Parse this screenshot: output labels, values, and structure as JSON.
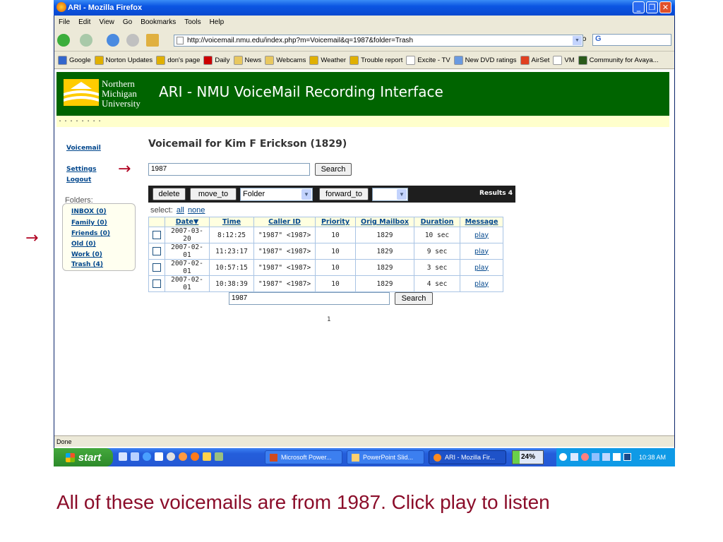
{
  "window": {
    "title": "ARI - Mozilla Firefox"
  },
  "menu": [
    "File",
    "Edit",
    "View",
    "Go",
    "Bookmarks",
    "Tools",
    "Help"
  ],
  "address": {
    "url": "http://voicemail.nmu.edu/index.php?m=Voicemail&q=1987&folder=Trash",
    "go_label": "Go",
    "search_engine": "G"
  },
  "bookmarks": [
    {
      "label": "Google",
      "color": "#3366cc"
    },
    {
      "label": "Norton Updates",
      "color": "#e0b000"
    },
    {
      "label": "don's page",
      "color": "#e0b000"
    },
    {
      "label": "Daily",
      "color": "#cc0000"
    },
    {
      "label": "News",
      "color": "#e8c860"
    },
    {
      "label": "Webcams",
      "color": "#e8c860"
    },
    {
      "label": "Weather",
      "color": "#e0b000"
    },
    {
      "label": "Trouble report",
      "color": "#e0b000"
    },
    {
      "label": "Excite - TV",
      "color": "#ffffff"
    },
    {
      "label": "New DVD ratings",
      "color": "#6a9ae0"
    },
    {
      "label": "AirSet",
      "color": "#e04020"
    },
    {
      "label": "VM",
      "color": "#ffffff"
    },
    {
      "label": "Community for Avaya...",
      "color": "#2a5a1a"
    }
  ],
  "header": {
    "logo_lines": [
      "Northern",
      "Michigan",
      "University"
    ],
    "title": "ARI - NMU VoiceMail Recording Interface",
    "dots": "........"
  },
  "nav": {
    "voicemail": "Voicemail",
    "settings": "Settings",
    "logout": "Logout",
    "folders_label": "Folders:"
  },
  "folders": [
    "INBOX (0)",
    "Family (0)",
    "Friends (0)",
    "Old (0)",
    "Work (0)",
    "Trash (4)"
  ],
  "page": {
    "title": "Voicemail for Kim F Erickson (1829)",
    "search_value": "1987",
    "search_label": "Search",
    "results_label": "Results 4",
    "select_label": "select:",
    "select_all": "all",
    "select_none": "none",
    "page_number": "1"
  },
  "actions": {
    "delete": "delete",
    "move_to": "move_to",
    "folder_select": "Folder",
    "forward_to": "forward_to",
    "forward_select": ""
  },
  "table": {
    "headers": [
      "Date▼",
      "Time",
      "Caller ID",
      "Priority",
      "Orig Mailbox",
      "Duration",
      "Message"
    ],
    "rows": [
      [
        "2007-03-20",
        "8:12:25",
        "\"1987\" <1987>",
        "10",
        "1829",
        "10 sec",
        "play"
      ],
      [
        "2007-02-01",
        "11:23:17",
        "\"1987\" <1987>",
        "10",
        "1829",
        "9 sec",
        "play"
      ],
      [
        "2007-02-01",
        "10:57:15",
        "\"1987\" <1987>",
        "10",
        "1829",
        "3 sec",
        "play"
      ],
      [
        "2007-02-01",
        "10:38:39",
        "\"1987\" <1987>",
        "10",
        "1829",
        "4 sec",
        "play"
      ]
    ]
  },
  "statusbar": {
    "text": "Done"
  },
  "taskbar": {
    "start": "start",
    "tasks": [
      "Microsoft Power...",
      "PowerPoint Slid...",
      "ARI - Mozilla Fir..."
    ],
    "battery": "24%",
    "clock": "10:38 AM"
  },
  "annotations": {
    "arrow": "→",
    "caption": "All of these voicemails are from 1987.  Click play to listen"
  }
}
